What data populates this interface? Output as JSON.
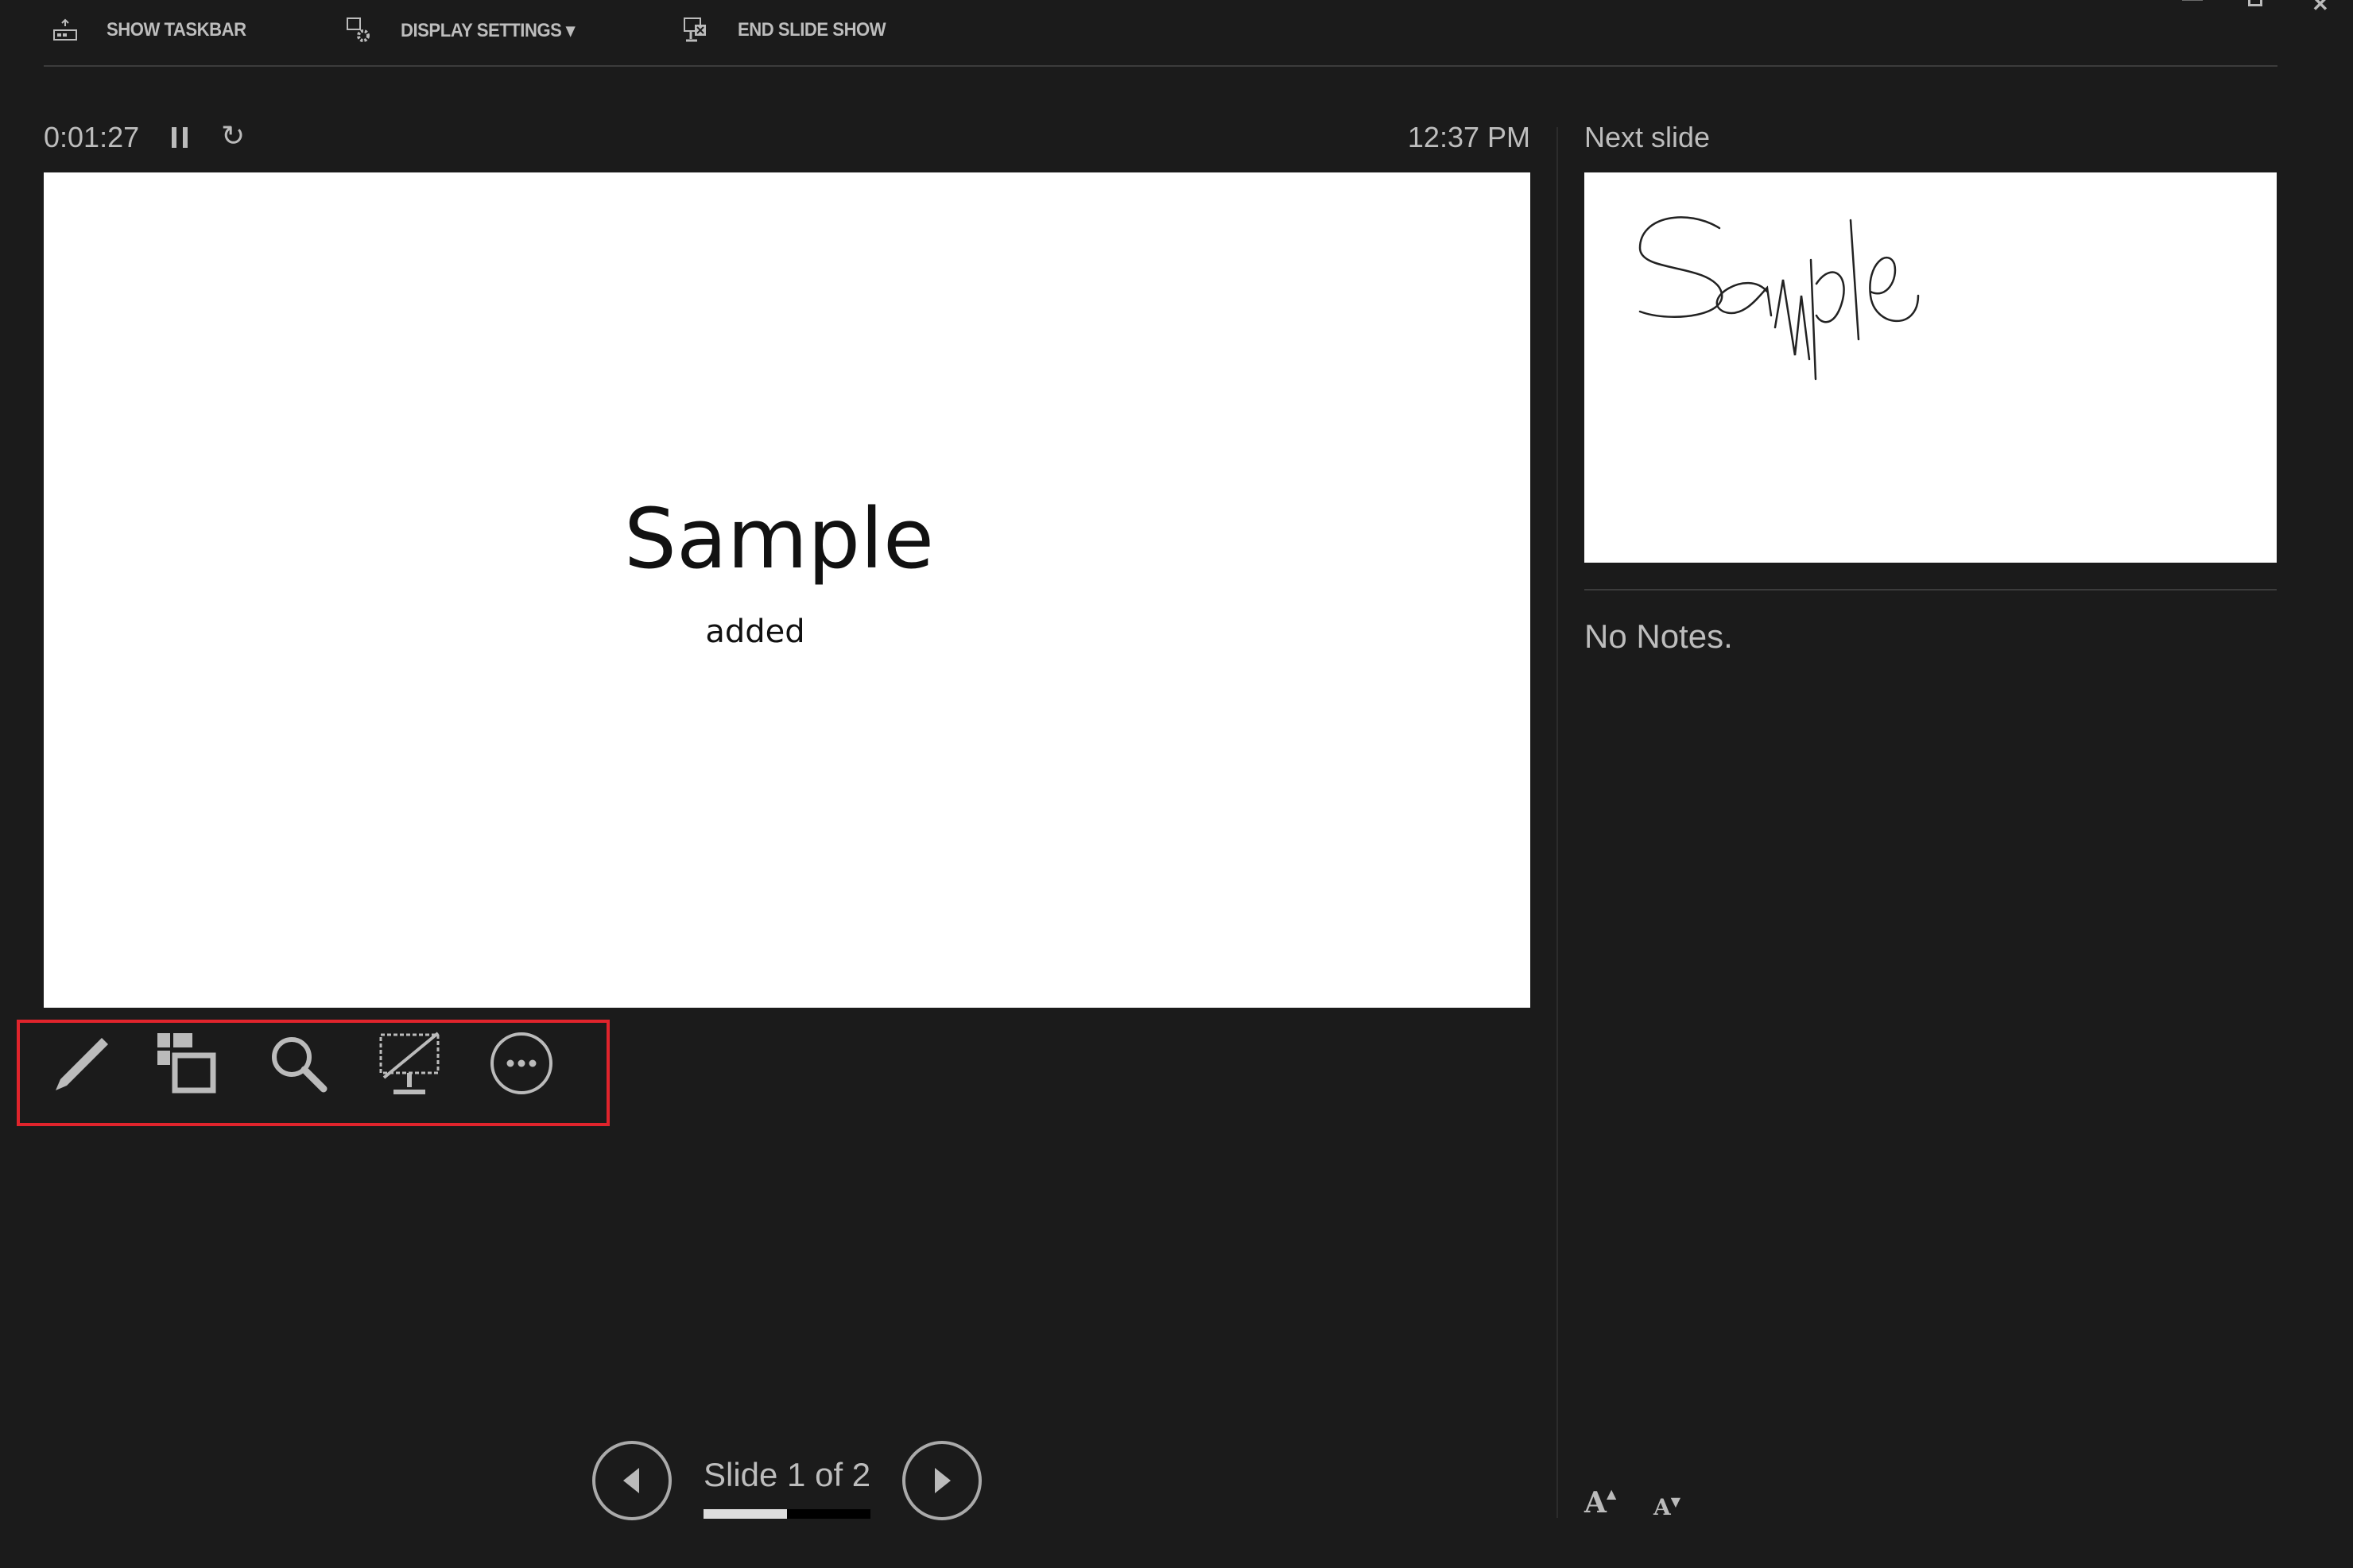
{
  "toolbar": {
    "show_taskbar": "SHOW TASKBAR",
    "display_settings": "DISPLAY SETTINGS",
    "end_slide_show": "END SLIDE SHOW"
  },
  "timer": {
    "elapsed": "0:01:27",
    "clock": "12:37 PM"
  },
  "current_slide": {
    "title": "Sample",
    "subtitle": "added"
  },
  "next_slide": {
    "label": "Next slide",
    "handwriting": "Sample"
  },
  "notes": {
    "text": "No Notes."
  },
  "navigation": {
    "label": "Slide 1 of 2",
    "current": 1,
    "total": 2,
    "progress_fraction": 0.5
  },
  "tools": [
    "pen-icon",
    "see-all-slides-icon",
    "zoom-icon",
    "black-screen-icon",
    "more-options-icon"
  ],
  "colors": {
    "background": "#1b1b1b",
    "highlight_box": "#e0242c",
    "text": "#c8c8c8"
  }
}
